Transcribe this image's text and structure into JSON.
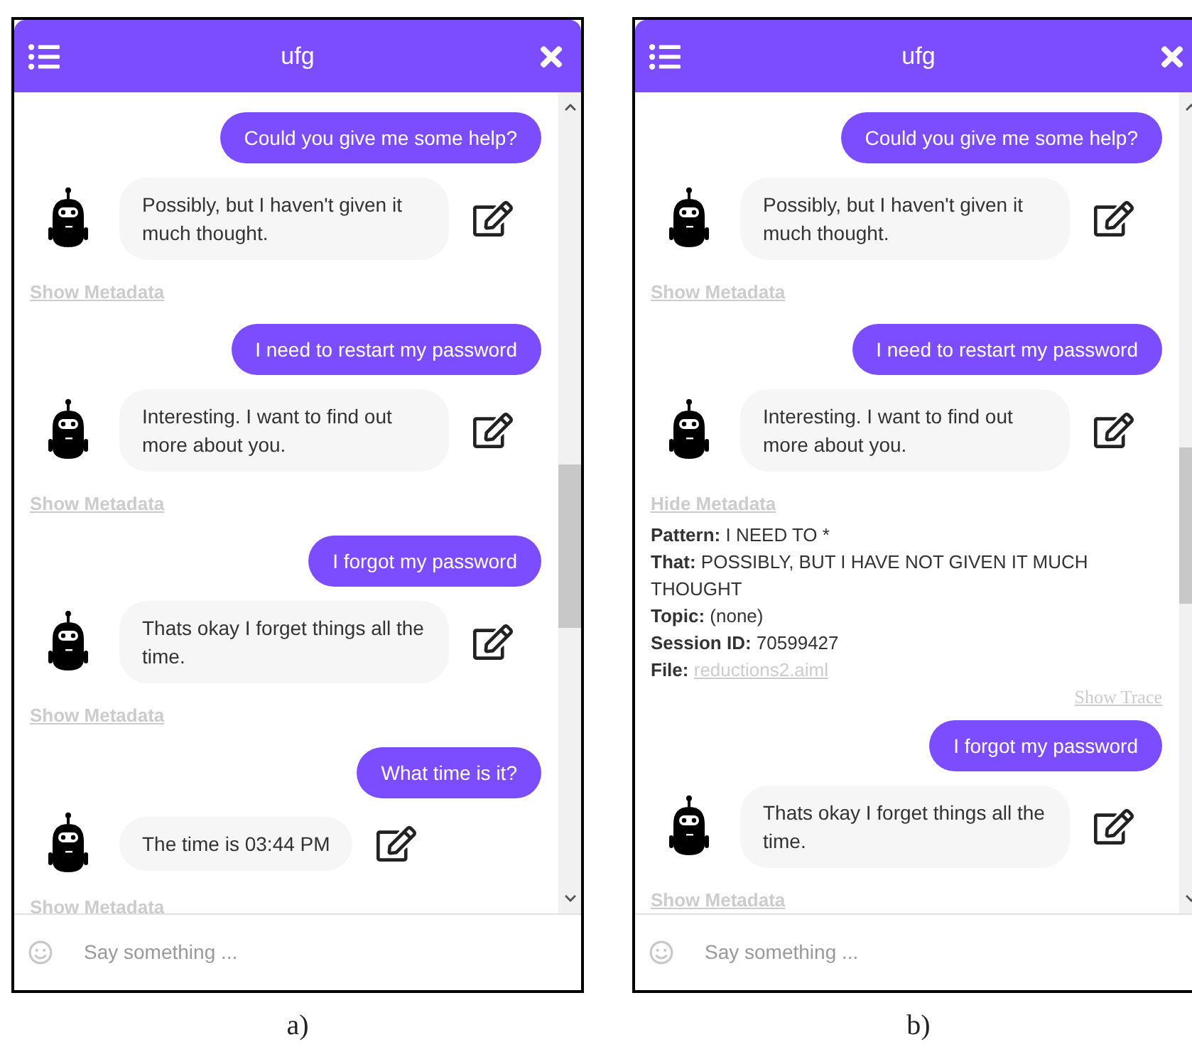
{
  "panels": [
    {
      "title": "ufg",
      "caption": "a)",
      "input": {
        "placeholder": "Say something ..."
      },
      "messages": [
        {
          "kind": "user",
          "text": "Could you give me some help?"
        },
        {
          "kind": "bot",
          "text": "Possibly, but I haven't given it much thought."
        },
        {
          "kind": "link",
          "text": "Show Metadata"
        },
        {
          "kind": "user",
          "text": "I need to restart my password"
        },
        {
          "kind": "bot",
          "text": "Interesting. I want to find out more about you."
        },
        {
          "kind": "link",
          "text": "Show Metadata"
        },
        {
          "kind": "user",
          "text": "I forgot my password"
        },
        {
          "kind": "bot",
          "text": "Thats okay I forget things all the time."
        },
        {
          "kind": "link",
          "text": "Show Metadata"
        },
        {
          "kind": "user",
          "text": "What time is it?"
        },
        {
          "kind": "bot",
          "text": "The time is 03:44 PM"
        },
        {
          "kind": "link",
          "text": "Show Metadata"
        }
      ]
    },
    {
      "title": "ufg",
      "caption": "b)",
      "input": {
        "placeholder": "Say something ..."
      },
      "messages": [
        {
          "kind": "user",
          "text": "Could you give me some help?"
        },
        {
          "kind": "bot",
          "text": "Possibly, but I haven't given it much thought."
        },
        {
          "kind": "link",
          "text": "Show Metadata"
        },
        {
          "kind": "user",
          "text": "I need to restart my password"
        },
        {
          "kind": "bot",
          "text": "Interesting. I want to find out more about you."
        },
        {
          "kind": "link",
          "text": "Hide Metadata"
        },
        {
          "kind": "metadata",
          "fields": [
            {
              "label": "Pattern:",
              "value": "I NEED TO *"
            },
            {
              "label": "That:",
              "value": "POSSIBLY, BUT I HAVE NOT GIVEN IT MUCH THOUGHT"
            },
            {
              "label": "Topic:",
              "value": "(none)"
            },
            {
              "label": "Session ID:",
              "value": "70599427"
            },
            {
              "label": "File:",
              "value": "reductions2.aiml",
              "link": true
            }
          ],
          "trace": "Show Trace"
        },
        {
          "kind": "user",
          "text": "I forgot my password"
        },
        {
          "kind": "bot",
          "text": "Thats okay I forget things all the time."
        },
        {
          "kind": "link",
          "text": "Show Metadata"
        }
      ]
    }
  ]
}
